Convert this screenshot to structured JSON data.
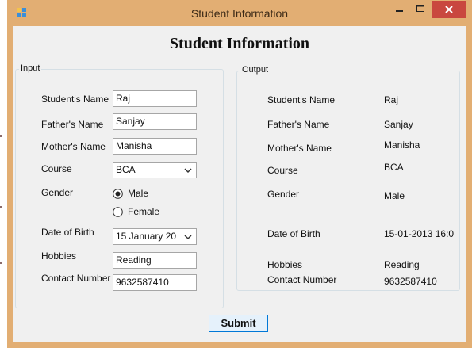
{
  "window": {
    "title": "Student Information",
    "accent": "#e2ae73",
    "close_color": "#c9473f",
    "icons": {
      "app": "app-icon",
      "minimize": "minimize-icon",
      "maximize": "maximize-icon",
      "close": "close-icon"
    }
  },
  "form": {
    "heading": "Student Information",
    "input_group": {
      "title": "Input",
      "labels": {
        "student_name": "Student's Name",
        "father_name": "Father's Name",
        "mother_name": "Mother's Name",
        "course": "Course",
        "gender": "Gender",
        "dob": "Date of Birth",
        "hobbies": "Hobbies",
        "contact": "Contact Number"
      },
      "values": {
        "student_name": "Raj",
        "father_name": "Sanjay",
        "mother_name": "Manisha",
        "course": "BCA",
        "dob": "15  January  20",
        "hobbies": "Reading",
        "contact": "9632587410"
      },
      "gender_options": [
        "Male",
        "Female"
      ],
      "gender_selected": "Male"
    },
    "output_group": {
      "title": "Output",
      "labels": {
        "student_name": "Student's Name",
        "father_name": "Father's Name",
        "mother_name": "Mother's Name",
        "course": "Course",
        "gender": "Gender",
        "dob": "Date of Birth",
        "hobbies": "Hobbies",
        "contact": "Contact Number"
      },
      "values": {
        "student_name": "Raj",
        "father_name": "Sanjay",
        "mother_name": "Manisha",
        "course": "BCA",
        "gender": "Male",
        "dob": "15-01-2013 16:0",
        "hobbies": "Reading",
        "contact": "9632587410"
      }
    },
    "submit_label": "Submit"
  }
}
